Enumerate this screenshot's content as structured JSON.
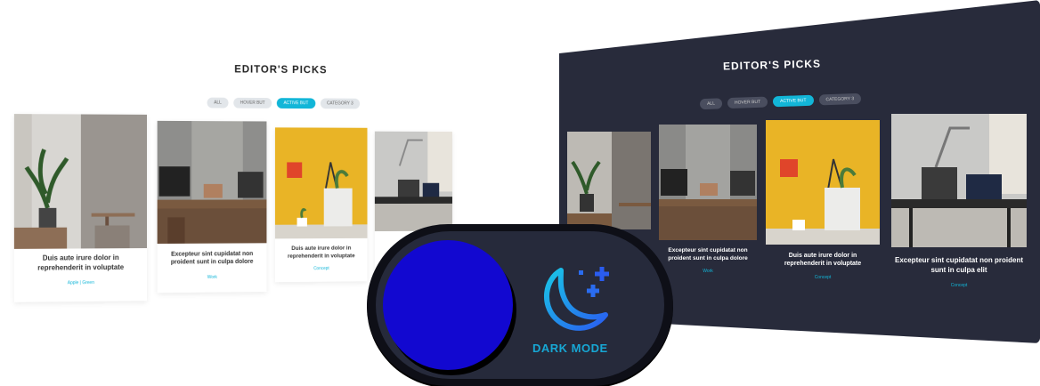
{
  "light": {
    "title": "EDITOR'S PICKS",
    "filters": [
      "ALL",
      "HOVER BUT",
      "ACTIVE BUT",
      "CATEGORY 3"
    ],
    "cards": [
      {
        "title": "Duis aute irure dolor in reprehenderit in voluptate",
        "category": "Apple   |   Green"
      },
      {
        "title": "Excepteur sint cupidatat non proident sunt in culpa dolore",
        "category": "Work"
      },
      {
        "title": "Duis aute irure dolor in reprehenderit in voluptate",
        "category": "Concept"
      },
      {
        "title": "",
        "category": ""
      }
    ]
  },
  "dark": {
    "title": "EDITOR'S PICKS",
    "filters": [
      "ALL",
      "HOVER BUT",
      "ACTIVE BUT",
      "CATEGORY 3"
    ],
    "cards": [
      {
        "title": "Excepteur sint cupidatat non proident sunt in culpa dolore",
        "category": "Work"
      },
      {
        "title": "Duis aute irure dolor in reprehenderit in voluptate",
        "category": "Concept"
      },
      {
        "title": "Excepteur sint cupidatat non proident sunt in culpa elit",
        "category": "Concept"
      }
    ]
  },
  "toggle": {
    "label": "DARK MODE",
    "icon": "moon-stars-icon",
    "colors": {
      "knob": "#1208d0",
      "track": "#262a3b",
      "accent": "#17a7d4"
    }
  },
  "colors": {
    "dark_bg": "#282b3b",
    "accent": "#12b6d8"
  }
}
